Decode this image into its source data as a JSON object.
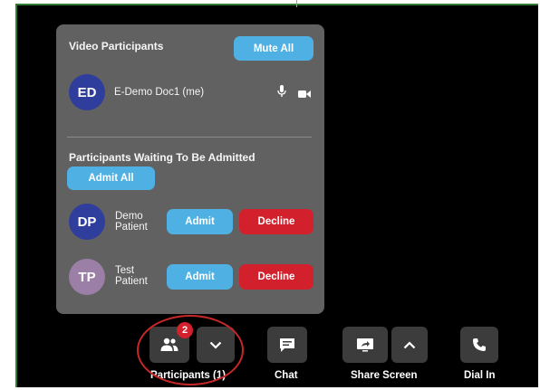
{
  "panel": {
    "video_title": "Video Participants",
    "mute_all": "Mute All",
    "me": {
      "initials": "ED",
      "name": "E-Demo Doc1 (me)"
    },
    "waiting_title": "Participants Waiting To Be Admitted",
    "admit_all": "Admit All",
    "waiting": [
      {
        "initials": "DP",
        "name_line1": "Demo",
        "name_line2": "Patient",
        "admit": "Admit",
        "decline": "Decline"
      },
      {
        "initials": "TP",
        "name_line1": "Test",
        "name_line2": "Patient",
        "admit": "Admit",
        "decline": "Decline"
      }
    ]
  },
  "toolbar": {
    "participants_label": "Participants (1)",
    "participants_badge": "2",
    "chat_label": "Chat",
    "share_label": "Share Screen",
    "dial_label": "Dial In"
  },
  "colors": {
    "accent_blue": "#4fb0e3",
    "decline_red": "#d3202d",
    "panel_bg": "#616161"
  }
}
